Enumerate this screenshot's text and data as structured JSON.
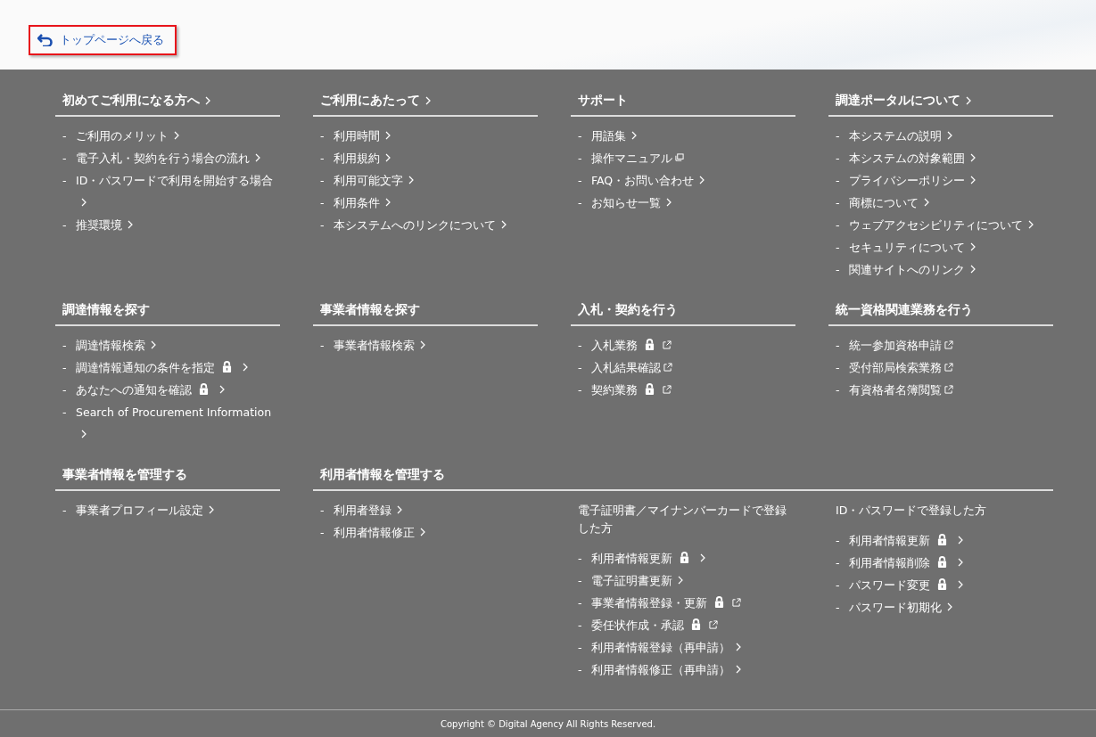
{
  "back_link": {
    "label": "トップページへ戻る",
    "highlighted": true
  },
  "bullet": "-",
  "rows": [
    [
      {
        "kind": "simple",
        "title": "初めてご利用になる方へ",
        "title_link": true,
        "items": [
          {
            "label": "ご利用のメリット",
            "locked": false,
            "kind": "page"
          },
          {
            "label": "電子入札・契約を行う場合の流れ",
            "locked": false,
            "kind": "page"
          },
          {
            "label": "ID・パスワードで利用を開始する場合",
            "locked": false,
            "kind": "page"
          },
          {
            "label": "推奨環境",
            "locked": false,
            "kind": "page"
          }
        ]
      },
      {
        "kind": "simple",
        "title": "ご利用にあたって",
        "title_link": true,
        "items": [
          {
            "label": "利用時間",
            "locked": false,
            "kind": "page"
          },
          {
            "label": "利用規約",
            "locked": false,
            "kind": "page"
          },
          {
            "label": "利用可能文字",
            "locked": false,
            "kind": "page"
          },
          {
            "label": "利用条件",
            "locked": false,
            "kind": "page"
          },
          {
            "label": "本システムへのリンクについて",
            "locked": false,
            "kind": "page"
          }
        ]
      },
      {
        "kind": "simple",
        "title": "サポート",
        "title_link": false,
        "items": [
          {
            "label": "用語集",
            "locked": false,
            "kind": "page"
          },
          {
            "label": "操作マニュアル",
            "locked": false,
            "kind": "window"
          },
          {
            "label": "FAQ・お問い合わせ",
            "locked": false,
            "kind": "page"
          },
          {
            "label": "お知らせ一覧",
            "locked": false,
            "kind": "page"
          }
        ]
      },
      {
        "kind": "simple",
        "title": "調達ポータルについて",
        "title_link": true,
        "items": [
          {
            "label": "本システムの説明",
            "locked": false,
            "kind": "page"
          },
          {
            "label": "本システムの対象範囲",
            "locked": false,
            "kind": "page"
          },
          {
            "label": "プライバシーポリシー",
            "locked": false,
            "kind": "page"
          },
          {
            "label": "商標について",
            "locked": false,
            "kind": "page"
          },
          {
            "label": "ウェブアクセシビリティについて",
            "locked": false,
            "kind": "page"
          },
          {
            "label": "セキュリティについて",
            "locked": false,
            "kind": "page"
          },
          {
            "label": "関連サイトへのリンク",
            "locked": false,
            "kind": "page"
          }
        ]
      }
    ],
    [
      {
        "kind": "simple",
        "title": "調達情報を探す",
        "title_link": false,
        "items": [
          {
            "label": "調達情報検索",
            "locked": false,
            "kind": "page"
          },
          {
            "label": "調達情報通知の条件を指定",
            "locked": true,
            "kind": "page"
          },
          {
            "label": "あなたへの通知を確認",
            "locked": true,
            "kind": "page"
          },
          {
            "label": "Search of Procurement Information",
            "locked": false,
            "kind": "page"
          }
        ]
      },
      {
        "kind": "simple",
        "title": "事業者情報を探す",
        "title_link": false,
        "items": [
          {
            "label": "事業者情報検索",
            "locked": false,
            "kind": "page"
          }
        ]
      },
      {
        "kind": "simple",
        "title": "入札・契約を行う",
        "title_link": false,
        "items": [
          {
            "label": "入札業務",
            "locked": true,
            "kind": "external"
          },
          {
            "label": "入札結果確認",
            "locked": false,
            "kind": "external"
          },
          {
            "label": "契約業務",
            "locked": true,
            "kind": "external"
          }
        ]
      },
      {
        "kind": "simple",
        "title": "統一資格関連業務を行う",
        "title_link": false,
        "items": [
          {
            "label": "統一参加資格申請",
            "locked": false,
            "kind": "external"
          },
          {
            "label": "受付部局検索業務",
            "locked": false,
            "kind": "external"
          },
          {
            "label": "有資格者名簿閲覧",
            "locked": false,
            "kind": "external"
          }
        ]
      }
    ],
    [
      {
        "kind": "simple",
        "title": "事業者情報を管理する",
        "title_link": false,
        "items": [
          {
            "label": "事業者プロフィール設定",
            "locked": false,
            "kind": "page"
          }
        ]
      },
      {
        "kind": "grouped",
        "title": "利用者情報を管理する",
        "title_link": false,
        "groups": [
          {
            "items": [
              {
                "label": "利用者登録",
                "locked": false,
                "kind": "page"
              },
              {
                "label": "利用者情報修正",
                "locked": false,
                "kind": "page"
              }
            ]
          },
          {
            "subtitle": "電子証明書／マイナンバーカードで登録した方",
            "items": [
              {
                "label": "利用者情報更新",
                "locked": true,
                "kind": "page"
              },
              {
                "label": "電子証明書更新",
                "locked": false,
                "kind": "page"
              },
              {
                "label": "事業者情報登録・更新",
                "locked": true,
                "kind": "external"
              },
              {
                "label": "委任状作成・承認",
                "locked": true,
                "kind": "external"
              },
              {
                "label": "利用者情報登録（再申請）",
                "locked": false,
                "kind": "page"
              },
              {
                "label": "利用者情報修正（再申請）",
                "locked": false,
                "kind": "page"
              }
            ]
          },
          {
            "subtitle": "ID・パスワードで登録した方",
            "items": [
              {
                "label": "利用者情報更新",
                "locked": true,
                "kind": "page"
              },
              {
                "label": "利用者情報削除",
                "locked": true,
                "kind": "page"
              },
              {
                "label": "パスワード変更",
                "locked": true,
                "kind": "page"
              },
              {
                "label": "パスワード初期化",
                "locked": false,
                "kind": "page"
              }
            ]
          }
        ]
      }
    ]
  ],
  "copyright": "Copyright © Digital Agency All Rights Reserved."
}
